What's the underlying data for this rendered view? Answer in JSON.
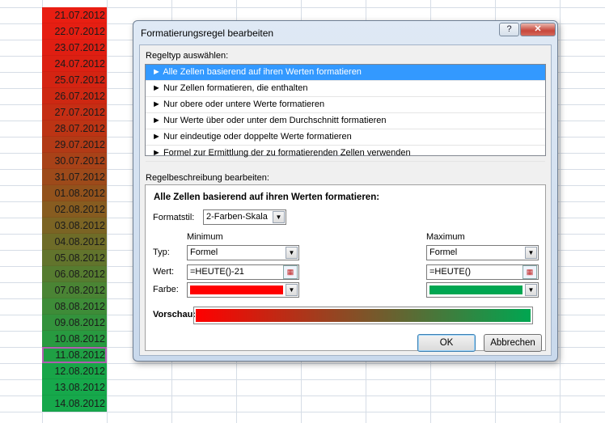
{
  "sheet": {
    "cells": [
      {
        "date": "21.07.2012",
        "color": "#e91e12"
      },
      {
        "date": "22.07.2012",
        "color": "#e51e12"
      },
      {
        "date": "23.07.2012",
        "color": "#e01e12"
      },
      {
        "date": "24.07.2012",
        "color": "#dc2012"
      },
      {
        "date": "25.07.2012",
        "color": "#d42412"
      },
      {
        "date": "26.07.2012",
        "color": "#cd2812"
      },
      {
        "date": "27.07.2012",
        "color": "#c52e14"
      },
      {
        "date": "28.07.2012",
        "color": "#bc3414"
      },
      {
        "date": "29.07.2012",
        "color": "#b23a16"
      },
      {
        "date": "30.07.2012",
        "color": "#a84218"
      },
      {
        "date": "31.07.2012",
        "color": "#9d4a1a"
      },
      {
        "date": "01.08.2012",
        "color": "#92521c"
      },
      {
        "date": "02.08.2012",
        "color": "#875c20"
      },
      {
        "date": "03.08.2012",
        "color": "#7b6424"
      },
      {
        "date": "04.08.2012",
        "color": "#6e6c28"
      },
      {
        "date": "05.08.2012",
        "color": "#62742c"
      },
      {
        "date": "06.08.2012",
        "color": "#567c30"
      },
      {
        "date": "07.08.2012",
        "color": "#4a8434"
      },
      {
        "date": "08.08.2012",
        "color": "#3e8c38"
      },
      {
        "date": "09.08.2012",
        "color": "#33923c"
      },
      {
        "date": "10.08.2012",
        "color": "#289a40"
      },
      {
        "date": "11.08.2012",
        "color": "#1fa044",
        "selected": true
      },
      {
        "date": "12.08.2012",
        "color": "#18a548"
      },
      {
        "date": "13.08.2012",
        "color": "#16a84b"
      },
      {
        "date": "14.08.2012",
        "color": "#16a84b"
      }
    ]
  },
  "dialog": {
    "title": "Formatierungsregel bearbeiten",
    "help_label": "?",
    "close_label": "✕",
    "rule_type_label": "Regeltyp auswählen:",
    "rule_types": [
      "► Alle Zellen basierend auf ihren Werten formatieren",
      "► Nur Zellen formatieren, die enthalten",
      "► Nur obere oder untere Werte formatieren",
      "► Nur Werte über oder unter dem Durchschnitt formatieren",
      "► Nur eindeutige oder doppelte Werte formatieren",
      "► Formel zur Ermittlung der zu formatierenden Zellen verwenden"
    ],
    "description_label": "Regelbeschreibung bearbeiten:",
    "description_heading": "Alle Zellen basierend auf ihren Werten formatieren:",
    "format_style_label": "Formatstil:",
    "format_style_value": "2-Farben-Skala",
    "minimum_label": "Minimum",
    "maximum_label": "Maximum",
    "type_label": "Typ:",
    "value_label": "Wert:",
    "color_label": "Farbe:",
    "min_type": "Formel",
    "max_type": "Formel",
    "min_value": "=HEUTE()-21",
    "max_value": "=HEUTE()",
    "min_color": "#ff0000",
    "max_color": "#00a651",
    "preview_label": "Vorschau:",
    "ok_label": "OK",
    "cancel_label": "Abbrechen"
  }
}
